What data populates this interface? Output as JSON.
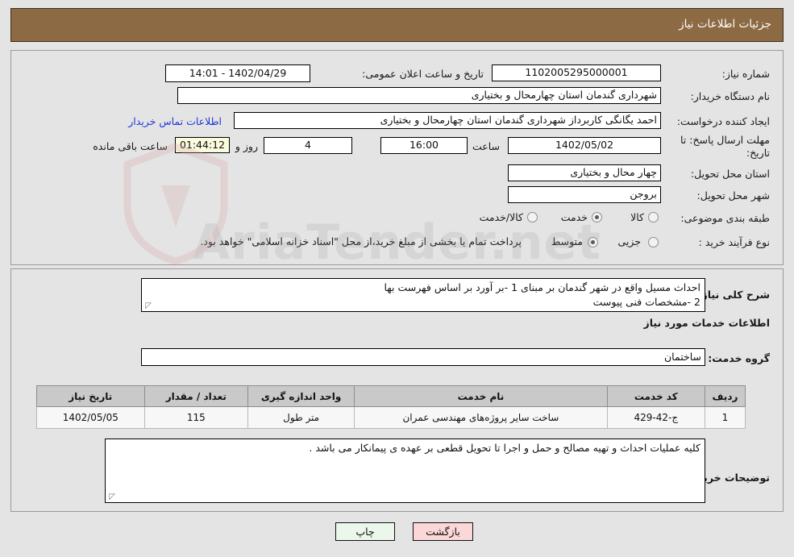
{
  "header": {
    "title": "جزئیات اطلاعات نیاز"
  },
  "top": {
    "need_number_label": "شماره نیاز:",
    "need_number_value": "1102005295000001",
    "announce_label": "تاریخ و ساعت اعلان عمومی:",
    "announce_value": "1402/04/29 - 14:01",
    "buyer_org_label": "نام دستگاه خریدار:",
    "buyer_org_value": "شهرداری گندمان استان چهارمحال و بختیاری",
    "requester_label": "ایجاد کننده درخواست:",
    "requester_value": "احمد یگانگی کاربرداز شهرداری گندمان استان چهارمحال و بختیاری",
    "contact_link": "اطلاعات تماس خریدار",
    "deadline_label": "مهلت ارسال پاسخ: تا تاریخ:",
    "deadline_date": "1402/05/02",
    "hour_label": "ساعت",
    "deadline_hour": "16:00",
    "days_value": "4",
    "days_label": "روز و",
    "countdown_value": "01:44:12",
    "countdown_label": "ساعت باقی مانده",
    "province_label": "استان محل تحویل:",
    "province_value": "چهار محال و بختیاری",
    "city_label": "شهر محل تحویل:",
    "city_value": "بروجن",
    "category_label": "طبقه بندی موضوعی:",
    "category_options": [
      {
        "label": "کالا",
        "selected": false
      },
      {
        "label": "خدمت",
        "selected": true
      },
      {
        "label": "کالا/خدمت",
        "selected": false
      }
    ],
    "process_label": "نوع فرآیند خرید :",
    "process_options": [
      {
        "label": "جزیی",
        "selected": false
      },
      {
        "label": "متوسط",
        "selected": true
      }
    ],
    "payment_note": "پرداخت تمام یا بخشی از مبلغ خرید،از محل \"اسناد خزانه اسلامی\" خواهد بود."
  },
  "mid": {
    "summary_label": "شرح کلی نیاز:",
    "summary_value": "احداث مسیل واقع در شهر گندمان بر مبنای 1 -بر آورد بر اساس فهرست بها\n2 -مشخصات فنی پیوست",
    "section_title": "اطلاعات خدمات مورد نیاز",
    "service_group_label": "گروه خدمت:",
    "service_group_value": "ساختمان",
    "table": {
      "columns": [
        "ردیف",
        "کد خدمت",
        "نام خدمت",
        "واحد اندازه گیری",
        "تعداد / مقدار",
        "تاریخ نیاز"
      ],
      "rows": [
        [
          "1",
          "ج-42-429",
          "ساخت سایر پروژه‌های مهندسی عمران",
          "متر طول",
          "115",
          "1402/05/05"
        ]
      ]
    },
    "buyer_notes_label": "توضیحات خریدار:",
    "buyer_notes_value": "کلیه عملیات احداث و تهیه مصالح و حمل و اجرا تا تحویل قطعی بر عهده ی پیمانکار می باشد ."
  },
  "footer": {
    "print_label": "چاپ",
    "back_label": "بازگشت"
  },
  "watermark": {
    "text": "AriaTender.net"
  },
  "colors": {
    "header_bg": "#8c6a43",
    "link": "#1d38d8",
    "countdown_bg": "#fbfbe0",
    "print_bg": "#eaf7ea",
    "back_bg": "#fbd7d7",
    "table_header_bg": "#c9c9c9"
  }
}
